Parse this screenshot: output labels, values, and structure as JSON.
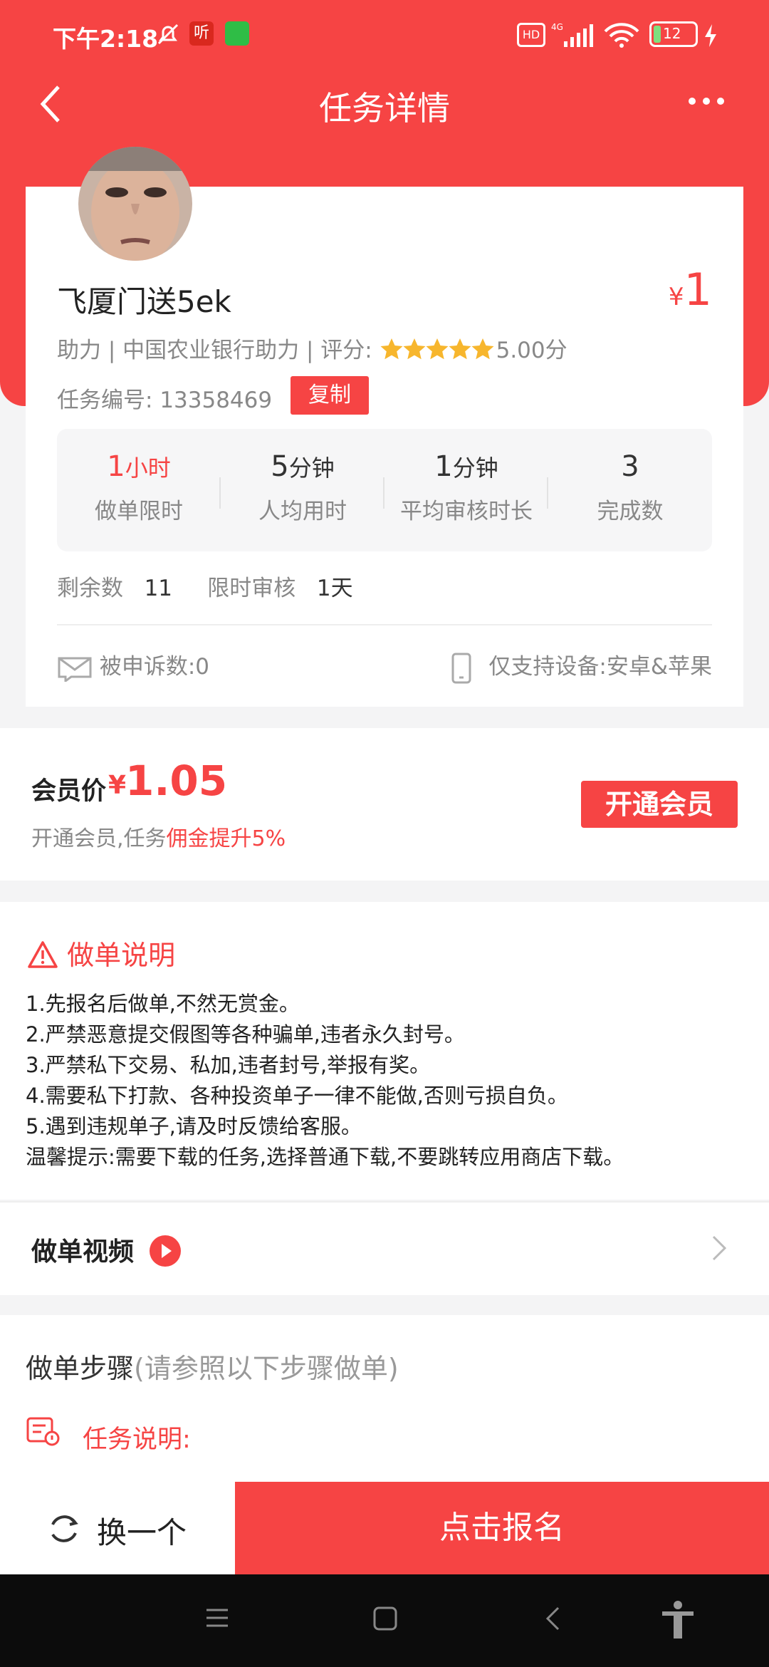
{
  "status_bar": {
    "time": "下午2:18",
    "battery": "12",
    "network": "4G"
  },
  "header": {
    "title": "任务详情"
  },
  "task": {
    "name": "飞厦门送5ek",
    "price_symbol": "¥",
    "price": "1",
    "meta": "助力 | 中国农业银行助力 | 评分:",
    "rating": "5.00分",
    "rating_stars": 5,
    "id_label": "任务编号:",
    "id_value": "13358469",
    "copy_label": "复制",
    "stats": [
      {
        "value": "1",
        "unit": "小时",
        "label": "做单限时"
      },
      {
        "value": "5",
        "unit": "分钟",
        "label": "人均用时"
      },
      {
        "value": "1",
        "unit": "分钟",
        "label": "平均审核时长"
      },
      {
        "value": "3",
        "unit": "",
        "label": "完成数"
      }
    ],
    "remain_label": "剩余数",
    "remain_value": "11",
    "review_label": "限时审核",
    "review_value": "1天",
    "complaint": "被申诉数:0",
    "devices": "仅支持设备:安卓&苹果"
  },
  "member": {
    "label": "会员价",
    "yen": "¥",
    "price": "1.05",
    "desc_prefix": "开通会员,任务",
    "desc_highlight": "佣金提升5%",
    "button": "开通会员"
  },
  "instructions": {
    "title": "做单说明",
    "lines": [
      "1.先报名后做单,不然无赏金。",
      "2.严禁恶意提交假图等各种骗单,违者永久封号。",
      "3.严禁私下交易、私加,违者封号,举报有奖。",
      "4.需要私下打款、各种投资单子一律不能做,否则亏损自负。",
      "5.遇到违规单子,请及时反馈给客服。",
      "温馨提示:需要下载的任务,选择普通下载,不要跳转应用商店下载。"
    ]
  },
  "video": {
    "title": "做单视频"
  },
  "steps": {
    "title": "做单步骤",
    "hint": "(请参照以下步骤做单)",
    "sub_title": "任务说明:"
  },
  "bottom": {
    "swap": "换一个",
    "signup": "点击报名"
  },
  "colors": {
    "accent": "#f64444",
    "background": "#f4f4f5"
  }
}
